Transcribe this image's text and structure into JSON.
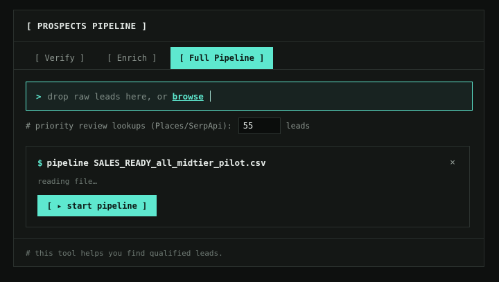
{
  "header": {
    "title": "[ PROSPECTS PIPELINE ]"
  },
  "tabs": [
    {
      "label": "[ Verify ]",
      "active": false
    },
    {
      "label": "[ Enrich ]",
      "active": false
    },
    {
      "label": "[ Full Pipeline ]",
      "active": true
    }
  ],
  "dropzone": {
    "prompt": ">",
    "text": "drop raw leads here, or",
    "browse_label": "browse"
  },
  "priority": {
    "label": "# priority review lookups (Places/SerpApi):",
    "value": "55",
    "unit": "leads"
  },
  "job": {
    "prompt": "$",
    "title": "pipeline SALES_READY_all_midtier_pilot.csv",
    "close_label": "×",
    "status": "reading file…",
    "start_label": "[ ▸ start pipeline ]"
  },
  "footer": {
    "text": "# this tool helps you find qualified leads."
  },
  "colors": {
    "accent": "#5ee8cf",
    "background": "#0e100f",
    "panel": "#141715"
  }
}
